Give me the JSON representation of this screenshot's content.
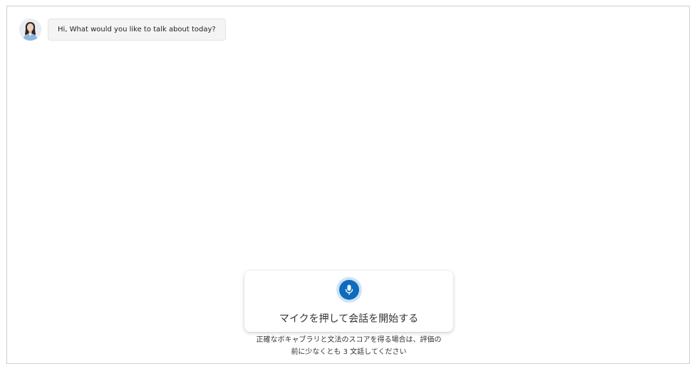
{
  "chat": {
    "assistant_message": "Hi, What would you like to talk about today?"
  },
  "mic": {
    "icon": "microphone-icon",
    "label": "マイクを押して会話を開始する",
    "accent_color": "#0f6cbd"
  },
  "hint": {
    "line1": "正確なボキャブラリと文法のスコアを得る場合は、評価の",
    "line2": "前に少なくとも 3 文話してください"
  }
}
